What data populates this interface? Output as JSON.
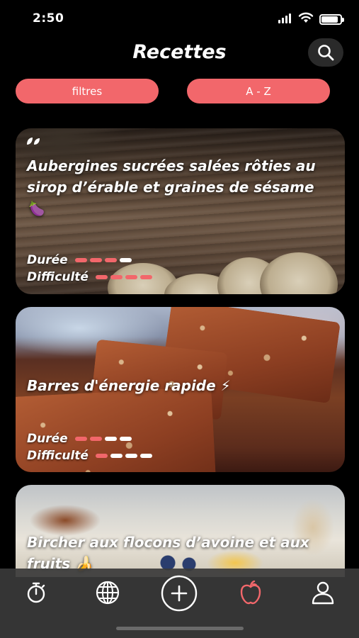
{
  "status_bar": {
    "time": "2:50",
    "battery_level": 0.9
  },
  "header": {
    "title": "Recettes",
    "search_icon": "search-icon"
  },
  "filters": {
    "filter_label": "filtres",
    "sort_label": "A - Z"
  },
  "recipes": [
    {
      "title": "Aubergines sucrées salées rôties au sirop d’érable et graines de sésame 🍆",
      "badge_icon": "leaf-icon",
      "duration_label": "Durée",
      "difficulty_label": "Difficulté",
      "duration_level": 3,
      "duration_max": 4,
      "difficulty_level": 4,
      "difficulty_max": 4
    },
    {
      "title": "Barres d'énergie rapide ⚡",
      "duration_label": "Durée",
      "difficulty_label": "Difficulté",
      "duration_level": 2,
      "duration_max": 4,
      "difficulty_level": 1,
      "difficulty_max": 4
    },
    {
      "title": "Bircher aux flocons d’avoine et aux fruits 🍌"
    }
  ],
  "tab_bar": {
    "tabs": [
      {
        "name": "timer",
        "icon": "stopwatch-icon"
      },
      {
        "name": "world",
        "icon": "globe-icon"
      },
      {
        "name": "add",
        "icon": "plus-circle-icon"
      },
      {
        "name": "recipes",
        "icon": "apple-icon",
        "active": true
      },
      {
        "name": "profile",
        "icon": "person-icon"
      }
    ]
  },
  "colors": {
    "accent": "#f2676b",
    "background": "#000000",
    "tab_bar": "#3a3a3a"
  }
}
